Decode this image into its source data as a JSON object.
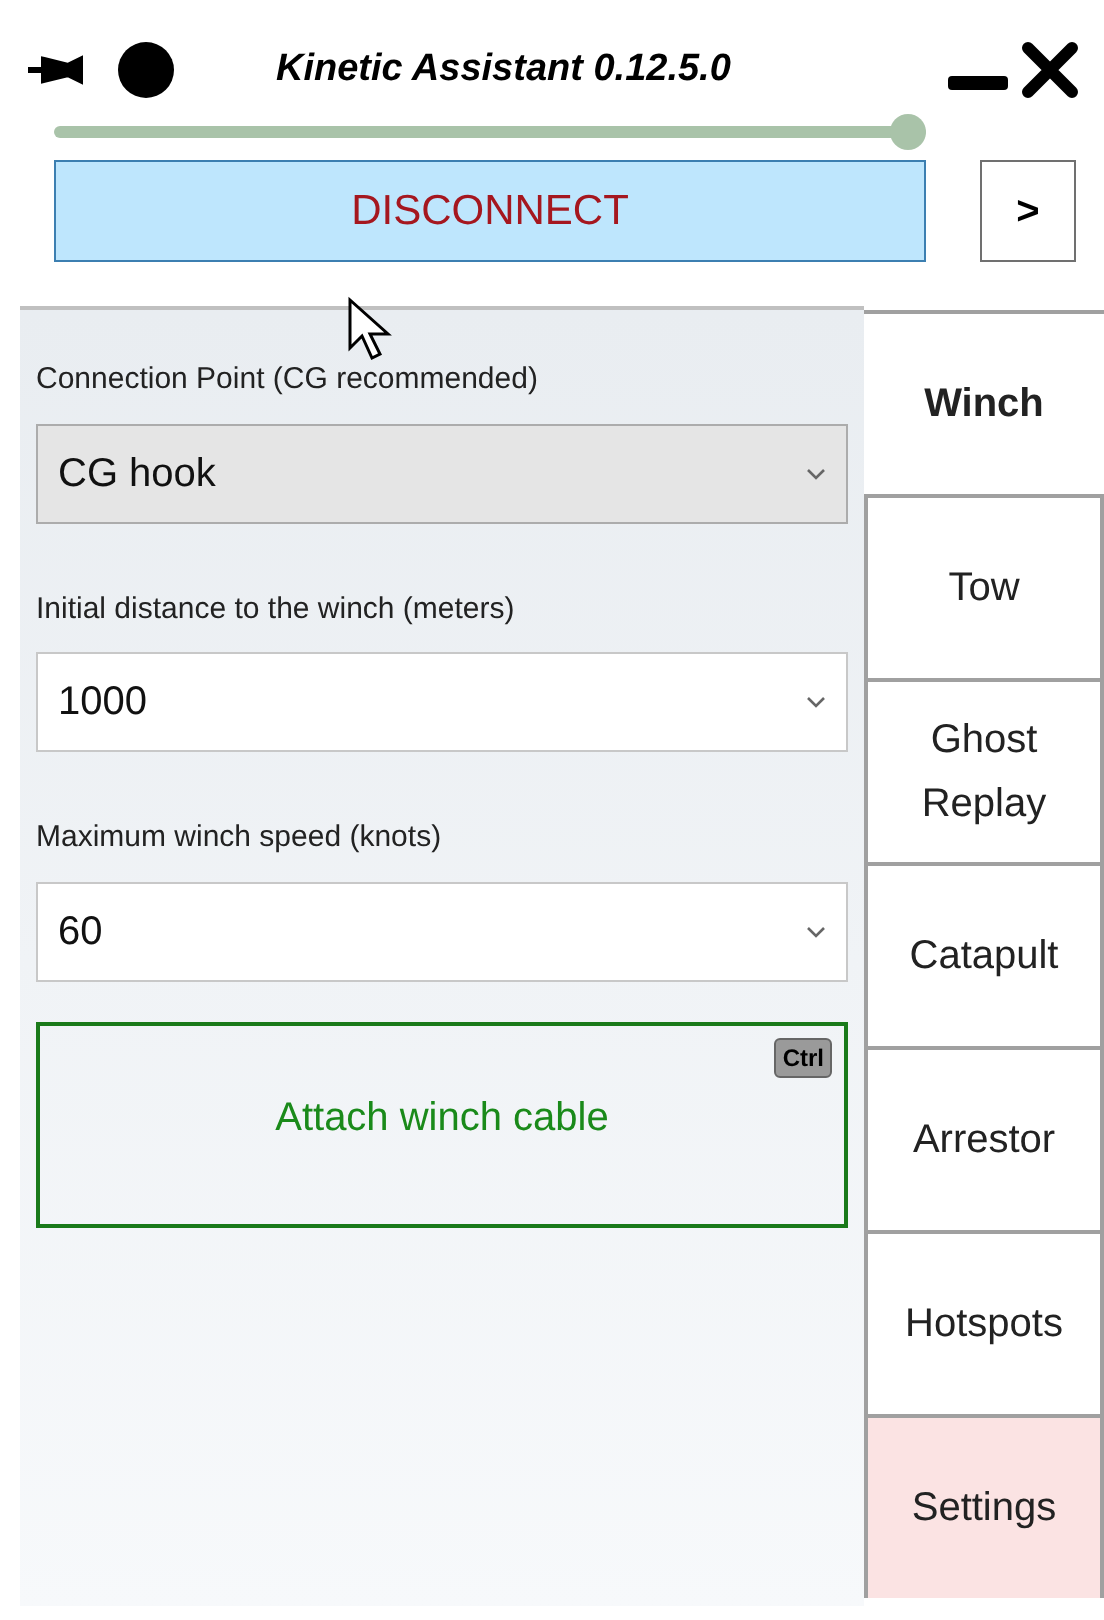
{
  "window": {
    "title": "Kinetic Assistant 0.12.5.0"
  },
  "slider": {
    "level": 0.98
  },
  "disconnect_button": "DISCONNECT",
  "expand_button": ">",
  "fields": [
    {
      "label": "Connection Point (CG recommended)",
      "value": "CG hook",
      "kind": "readonly"
    },
    {
      "label": "Initial distance to the winch (meters)",
      "value": "1000",
      "kind": "editable"
    },
    {
      "label": "Maximum winch speed (knots)",
      "value": "60",
      "kind": "editable"
    }
  ],
  "attach_button": {
    "label": "Attach winch cable",
    "shortcut": "Ctrl"
  },
  "tabs": [
    {
      "label": "Winch",
      "selected": true,
      "highlighted": false
    },
    {
      "label": "Tow",
      "selected": false,
      "highlighted": false
    },
    {
      "label": "Ghost Replay",
      "selected": false,
      "highlighted": false
    },
    {
      "label": "Catapult",
      "selected": false,
      "highlighted": false
    },
    {
      "label": "Arrestor",
      "selected": false,
      "highlighted": false
    },
    {
      "label": "Hotspots",
      "selected": false,
      "highlighted": false
    },
    {
      "label": "Settings",
      "selected": false,
      "highlighted": true
    }
  ]
}
